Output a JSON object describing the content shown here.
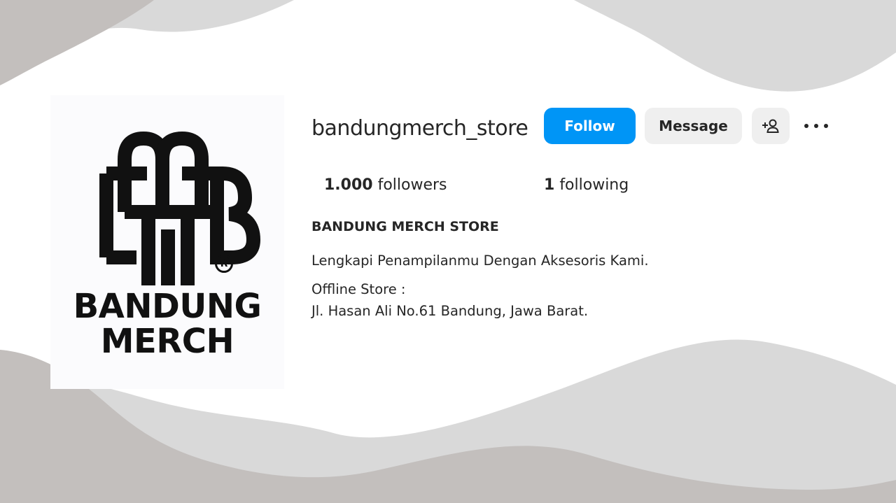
{
  "profile": {
    "username": "bandungmerch_store",
    "logo_text_line1": "BANDUNG",
    "logo_text_line2": "MERCH",
    "logo_registered_mark": "R"
  },
  "actions": {
    "follow_label": "Follow",
    "message_label": "Message",
    "add_user_icon": "add-user-icon",
    "more_icon": "more-options-icon"
  },
  "stats": {
    "followers_count": "1.000",
    "followers_label": "followers",
    "following_count": "1",
    "following_label": "following"
  },
  "bio": {
    "name": "BANDUNG MERCH STORE",
    "tagline": "Lengkapi Penampilanmu Dengan Aksesoris Kami.",
    "store_label": "Offline Store :",
    "address": "Jl. Hasan Ali No.61 Bandung, Jawa Barat."
  },
  "colors": {
    "follow_button": "#0095f6",
    "secondary_button": "#efefef",
    "text": "#262626",
    "wave_dark": "#c3bfbd",
    "wave_light": "#d9d9d9"
  }
}
